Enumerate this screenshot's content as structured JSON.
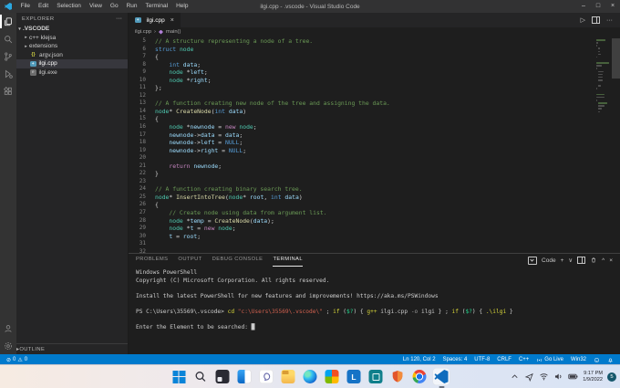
{
  "window": {
    "title": "ilgi.cpp - .vscode - Visual Studio Code",
    "menus": [
      "File",
      "Edit",
      "Selection",
      "View",
      "Go",
      "Run",
      "Terminal",
      "Help"
    ],
    "controls": {
      "minimize": "–",
      "maximize": "□",
      "close": "×"
    }
  },
  "glyphs": {
    "chevron_right": "▸",
    "chevron_down": "▾",
    "crumb_sep": "›",
    "ellipsis": "···",
    "run": "▷",
    "close": "×",
    "plus": "+",
    "dropdown": "∨",
    "panel_up": "^",
    "json_braces": "{}",
    "cpp_badge": "+",
    "exe_badge": "e",
    "error": "⊘",
    "warning": "⚠"
  },
  "activity_bar": {
    "active": "explorer",
    "top": [
      "explorer",
      "search",
      "source-control",
      "run-debug",
      "extensions"
    ],
    "bottom": [
      "account",
      "settings"
    ]
  },
  "sidebar": {
    "header": "EXPLORER",
    "root": ".VSCODE",
    "items": [
      {
        "label": "c++ klejsa",
        "type": "folder"
      },
      {
        "label": "extensions",
        "type": "folder"
      },
      {
        "label": "argv.json",
        "type": "json"
      },
      {
        "label": "ilgi.cpp",
        "type": "cpp",
        "selected": true
      },
      {
        "label": "ilgi.exe",
        "type": "exe"
      }
    ],
    "outline": "OUTLINE"
  },
  "editor": {
    "tab": "ilgi.cpp",
    "breadcrumb_file": "ilgi.cpp",
    "breadcrumb_symbol": "main()",
    "lines": [
      {
        "n": 5,
        "s": [
          [
            "// A structure representing a node of a tree.",
            "cmt"
          ]
        ]
      },
      {
        "n": 6,
        "s": [
          [
            "struct",
            "kw"
          ],
          [
            " ",
            "pl"
          ],
          [
            "node",
            "ty"
          ]
        ]
      },
      {
        "n": 7,
        "s": [
          [
            "{",
            "pl"
          ]
        ]
      },
      {
        "n": 8,
        "s": [
          [
            "    ",
            "pl"
          ],
          [
            "int",
            "kw"
          ],
          [
            " ",
            "pl"
          ],
          [
            "data",
            "va"
          ],
          [
            ";",
            "pl"
          ]
        ]
      },
      {
        "n": 9,
        "s": [
          [
            "    ",
            "pl"
          ],
          [
            "node",
            "ty"
          ],
          [
            " *",
            "pl"
          ],
          [
            "left",
            "va"
          ],
          [
            ";",
            "pl"
          ]
        ]
      },
      {
        "n": 10,
        "s": [
          [
            "    ",
            "pl"
          ],
          [
            "node",
            "ty"
          ],
          [
            " *",
            "pl"
          ],
          [
            "right",
            "va"
          ],
          [
            ";",
            "pl"
          ]
        ]
      },
      {
        "n": 11,
        "s": [
          [
            "};",
            "pl"
          ]
        ]
      },
      {
        "n": 12,
        "s": []
      },
      {
        "n": 13,
        "s": [
          [
            "// A function creating new node of the tree and assigning the data.",
            "cmt"
          ]
        ]
      },
      {
        "n": 14,
        "s": [
          [
            "node",
            "ty"
          ],
          [
            "* ",
            "pl"
          ],
          [
            "CreateNode",
            "fn"
          ],
          [
            "(",
            "pl"
          ],
          [
            "int",
            "kw"
          ],
          [
            " ",
            "pl"
          ],
          [
            "data",
            "va"
          ],
          [
            ")",
            "pl"
          ]
        ]
      },
      {
        "n": 15,
        "s": [
          [
            "{",
            "pl"
          ]
        ]
      },
      {
        "n": 16,
        "s": [
          [
            "    ",
            "pl"
          ],
          [
            "node",
            "ty"
          ],
          [
            " *",
            "pl"
          ],
          [
            "newnode",
            "va"
          ],
          [
            " = ",
            "pl"
          ],
          [
            "new",
            "ct"
          ],
          [
            " ",
            "pl"
          ],
          [
            "node",
            "ty"
          ],
          [
            ";",
            "pl"
          ]
        ]
      },
      {
        "n": 17,
        "s": [
          [
            "    ",
            "pl"
          ],
          [
            "newnode",
            "va"
          ],
          [
            "->",
            "pl"
          ],
          [
            "data",
            "va"
          ],
          [
            " = ",
            "pl"
          ],
          [
            "data",
            "va"
          ],
          [
            ";",
            "pl"
          ]
        ]
      },
      {
        "n": 18,
        "s": [
          [
            "    ",
            "pl"
          ],
          [
            "newnode",
            "va"
          ],
          [
            "->",
            "pl"
          ],
          [
            "left",
            "va"
          ],
          [
            " = ",
            "pl"
          ],
          [
            "NULL",
            "kw"
          ],
          [
            ";",
            "pl"
          ]
        ]
      },
      {
        "n": 19,
        "s": [
          [
            "    ",
            "pl"
          ],
          [
            "newnode",
            "va"
          ],
          [
            "->",
            "pl"
          ],
          [
            "right",
            "va"
          ],
          [
            " = ",
            "pl"
          ],
          [
            "NULL",
            "kw"
          ],
          [
            ";",
            "pl"
          ]
        ]
      },
      {
        "n": 20,
        "s": []
      },
      {
        "n": 21,
        "s": [
          [
            "    ",
            "pl"
          ],
          [
            "return",
            "ct"
          ],
          [
            " ",
            "pl"
          ],
          [
            "newnode",
            "va"
          ],
          [
            ";",
            "pl"
          ]
        ]
      },
      {
        "n": 22,
        "s": [
          [
            "}",
            "pl"
          ]
        ]
      },
      {
        "n": 23,
        "s": []
      },
      {
        "n": 24,
        "s": [
          [
            "// A function creating binary search tree.",
            "cmt"
          ]
        ]
      },
      {
        "n": 25,
        "s": [
          [
            "node",
            "ty"
          ],
          [
            "* ",
            "pl"
          ],
          [
            "InsertIntoTree",
            "fn"
          ],
          [
            "(",
            "pl"
          ],
          [
            "node",
            "ty"
          ],
          [
            "* ",
            "pl"
          ],
          [
            "root",
            "va"
          ],
          [
            ", ",
            "pl"
          ],
          [
            "int",
            "kw"
          ],
          [
            " ",
            "pl"
          ],
          [
            "data",
            "va"
          ],
          [
            ")",
            "pl"
          ]
        ]
      },
      {
        "n": 26,
        "s": [
          [
            "{",
            "pl"
          ]
        ]
      },
      {
        "n": 27,
        "s": [
          [
            "    ",
            "pl"
          ],
          [
            "// Create node using data from argument list.",
            "cmt"
          ]
        ]
      },
      {
        "n": 28,
        "s": [
          [
            "    ",
            "pl"
          ],
          [
            "node",
            "ty"
          ],
          [
            " *",
            "pl"
          ],
          [
            "temp",
            "va"
          ],
          [
            " = ",
            "pl"
          ],
          [
            "CreateNode",
            "fn"
          ],
          [
            "(",
            "pl"
          ],
          [
            "data",
            "va"
          ],
          [
            ");",
            "pl"
          ]
        ]
      },
      {
        "n": 29,
        "s": [
          [
            "    ",
            "pl"
          ],
          [
            "node",
            "ty"
          ],
          [
            " *",
            "pl"
          ],
          [
            "t",
            "va"
          ],
          [
            " = ",
            "pl"
          ],
          [
            "new",
            "ct"
          ],
          [
            " ",
            "pl"
          ],
          [
            "node",
            "ty"
          ],
          [
            ";",
            "pl"
          ]
        ]
      },
      {
        "n": 30,
        "s": [
          [
            "    ",
            "pl"
          ],
          [
            "t",
            "va"
          ],
          [
            " = ",
            "pl"
          ],
          [
            "root",
            "va"
          ],
          [
            ";",
            "pl"
          ]
        ]
      },
      {
        "n": 31,
        "s": []
      },
      {
        "n": 32,
        "s": []
      }
    ]
  },
  "panel": {
    "tabs": [
      "PROBLEMS",
      "OUTPUT",
      "DEBUG CONSOLE",
      "TERMINAL"
    ],
    "active": "TERMINAL",
    "shell_label": "Code",
    "lines": [
      [
        [
          "Windows PowerShell",
          "w"
        ]
      ],
      [
        [
          "Copyright (C) Microsoft Corporation. All rights reserved.",
          "w"
        ]
      ],
      [],
      [
        [
          "Install the latest PowerShell for new features and improvements! https://aka.ms/PSWindows",
          "w"
        ]
      ],
      [],
      [
        [
          "PS C:\\Users\\35569\\.vscode> ",
          "w"
        ],
        [
          "cd",
          "y"
        ],
        [
          " ",
          "w"
        ],
        [
          "\"c:\\Users\\35569\\.vscode\\\"",
          "r"
        ],
        [
          " ; ",
          "w"
        ],
        [
          "if",
          "y"
        ],
        [
          " (",
          "w"
        ],
        [
          "$?",
          "g"
        ],
        [
          ") { ",
          "w"
        ],
        [
          "g++",
          "y"
        ],
        [
          " ilgi.cpp ",
          "w"
        ],
        [
          "-o",
          "p"
        ],
        [
          " ilgi } ; ",
          "w"
        ],
        [
          "if",
          "y"
        ],
        [
          " (",
          "w"
        ],
        [
          "$?",
          "g"
        ],
        [
          ") { ",
          "w"
        ],
        [
          ".\\ilgi",
          "y"
        ],
        [
          " }",
          "w"
        ]
      ],
      [],
      [
        [
          "Enter the Element to be searched: ",
          "w"
        ],
        [
          "█",
          "w"
        ]
      ]
    ]
  },
  "status_bar": {
    "errors": "0",
    "warnings": "0",
    "line_col": "Ln 120, Col 2",
    "spaces": "Spaces: 4",
    "encoding": "UTF-8",
    "eol": "CRLF",
    "language": "C++",
    "golive": "Go Live",
    "platform": "Win32"
  },
  "taskbar": {
    "apps": [
      {
        "name": "start"
      },
      {
        "name": "search"
      },
      {
        "name": "task-view"
      },
      {
        "name": "widgets"
      },
      {
        "name": "chat"
      },
      {
        "name": "file-explorer"
      },
      {
        "name": "edge"
      },
      {
        "name": "photos"
      },
      {
        "name": "app-l",
        "letter": "L"
      },
      {
        "name": "app-teal"
      },
      {
        "name": "security-shield"
      },
      {
        "name": "chrome"
      },
      {
        "name": "vscode",
        "active": true
      }
    ],
    "time": "9:17 PM",
    "date": "1/9/2022",
    "badge": "5"
  },
  "colors": {
    "accent": "#007acc",
    "editor_bg": "#1e1e1e",
    "sidebar_bg": "#252526",
    "titlebar_bg": "#323233",
    "comment": "#6a9955",
    "keyword": "#569cd6",
    "control": "#c586c0",
    "type": "#4ec9b0",
    "function": "#dcdcaa",
    "variable": "#9cdcfe"
  }
}
